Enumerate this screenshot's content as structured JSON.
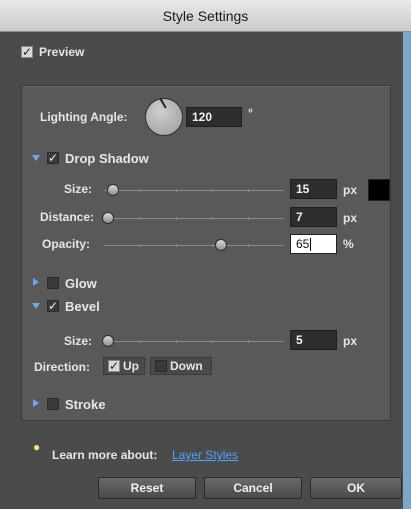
{
  "window": {
    "title": "Style Settings"
  },
  "preview": {
    "checked": true,
    "label": "Preview"
  },
  "lighting": {
    "label": "Lighting Angle:",
    "value": "120",
    "unit": "°"
  },
  "drop_shadow": {
    "label": "Drop Shadow",
    "checked": true,
    "expanded": true,
    "size": {
      "label": "Size:",
      "value": "15",
      "unit": "px",
      "fraction": 0.05
    },
    "distance": {
      "label": "Distance:",
      "value": "7",
      "unit": "px",
      "fraction": 0.02
    },
    "opacity": {
      "label": "Opacity:",
      "value": "65",
      "unit": "%",
      "fraction": 0.65
    },
    "color": "#000000"
  },
  "glow": {
    "label": "Glow",
    "checked": false,
    "expanded": false
  },
  "bevel": {
    "label": "Bevel",
    "checked": true,
    "expanded": true,
    "size": {
      "label": "Size:",
      "value": "5",
      "unit": "px",
      "fraction": 0.02
    },
    "direction": {
      "label": "Direction:",
      "up_label": "Up",
      "up_checked": true,
      "down_label": "Down",
      "down_checked": false
    }
  },
  "stroke": {
    "label": "Stroke",
    "checked": false,
    "expanded": false
  },
  "help": {
    "text": "Learn more about:",
    "link": "Layer Styles",
    "icon": "lightbulb-icon"
  },
  "buttons": {
    "reset": "Reset",
    "cancel": "Cancel",
    "ok": "OK"
  },
  "colors": {
    "accent": "#4fa0ff",
    "expander": "#6ea8e8"
  }
}
